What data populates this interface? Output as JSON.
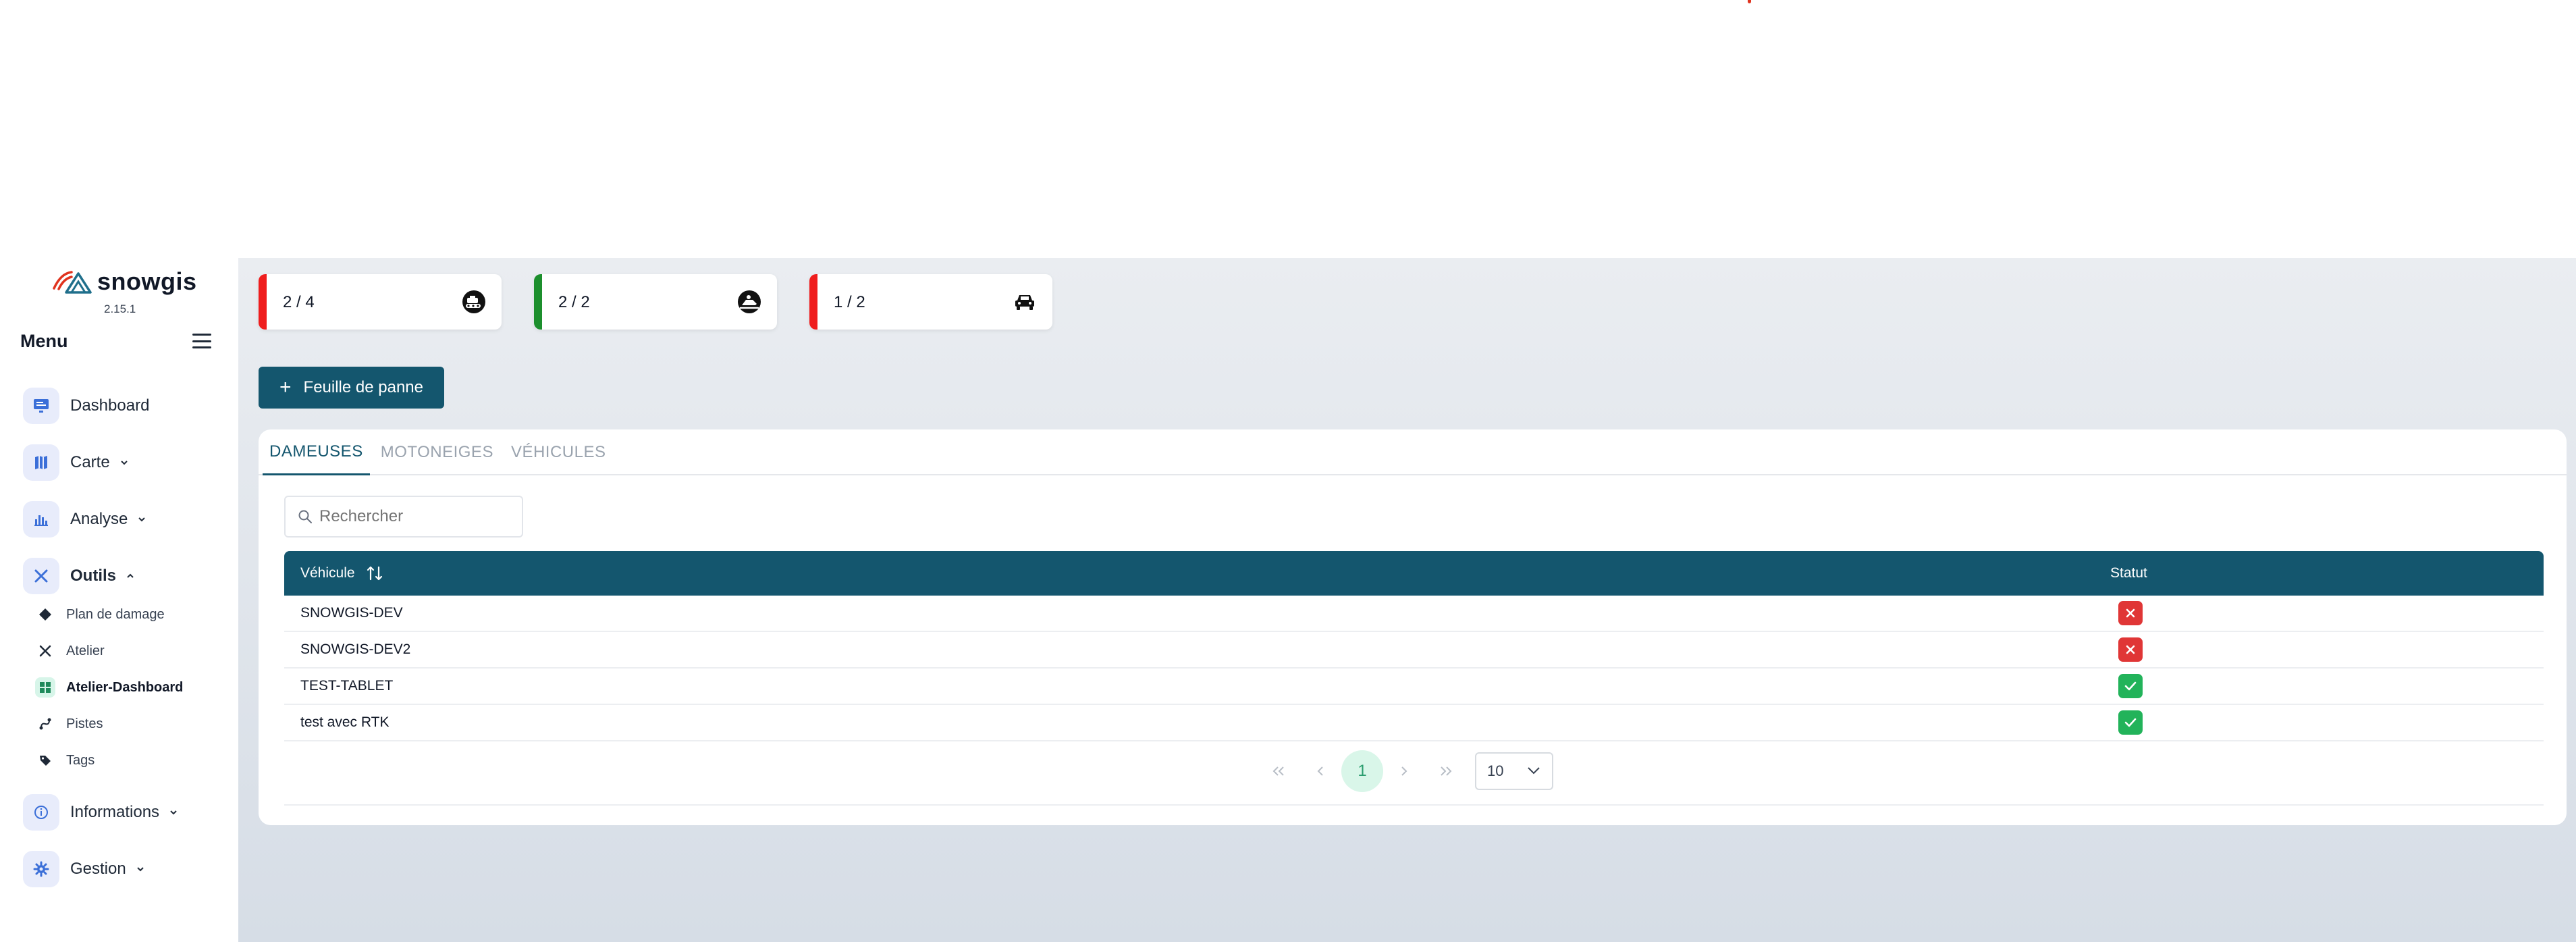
{
  "colors": {
    "primary": "#14566e",
    "danger": "#e03636",
    "success": "#22b35a",
    "kpi_red": "#ef1d1d",
    "kpi_green": "#1c8f2d"
  },
  "sidebar": {
    "brand": "snowgis",
    "version": "2.15.1",
    "menu_title": "Menu",
    "items": [
      {
        "label": "Dashboard",
        "icon": "monitor-icon"
      },
      {
        "label": "Carte",
        "icon": "map-icon"
      },
      {
        "label": "Analyse",
        "icon": "bar-chart-icon"
      },
      {
        "label": "Outils",
        "icon": "tools-icon"
      },
      {
        "label": "Informations",
        "icon": "info-icon"
      },
      {
        "label": "Gestion",
        "icon": "gear-icon"
      }
    ],
    "subitems": [
      {
        "label": "Plan de damage",
        "icon": "diamond-icon"
      },
      {
        "label": "Atelier",
        "icon": "tools-icon"
      },
      {
        "label": "Atelier-Dashboard",
        "icon": "grid-icon"
      },
      {
        "label": "Pistes",
        "icon": "route-icon"
      },
      {
        "label": "Tags",
        "icon": "tag-icon"
      }
    ]
  },
  "kpis": [
    {
      "value": "2 / 4",
      "icon": "snowcat-icon",
      "status": "red"
    },
    {
      "value": "2 / 2",
      "icon": "snowmobile-icon",
      "status": "green"
    },
    {
      "value": "1 / 2",
      "icon": "car-icon",
      "status": "red"
    }
  ],
  "actions": {
    "new_sheet": "Feuille de panne"
  },
  "tabs": [
    "DAMEUSES",
    "MOTONEIGES",
    "VÉHICULES"
  ],
  "search": {
    "placeholder": "Rechercher"
  },
  "table": {
    "columns": [
      "Véhicule",
      "Statut"
    ],
    "rows": [
      {
        "vehicule": "SNOWGIS-DEV",
        "statut": "error"
      },
      {
        "vehicule": "SNOWGIS-DEV2",
        "statut": "error"
      },
      {
        "vehicule": "TEST-TABLET",
        "statut": "ok"
      },
      {
        "vehicule": "test avec RTK",
        "statut": "ok"
      }
    ]
  },
  "pagination": {
    "current_page": "1",
    "page_size": "10"
  }
}
